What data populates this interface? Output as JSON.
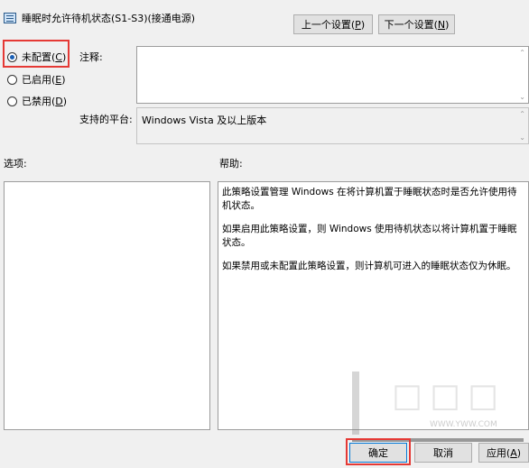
{
  "window": {
    "title": "睡眠时允许待机状态(S1-S3)(接通电源)"
  },
  "nav": {
    "prev_prefix": "上一个设置(",
    "prev_key": "P",
    "suffix": ")",
    "next_prefix": "下一个设置(",
    "next_key": "N"
  },
  "options": {
    "not_configured_prefix": "未配置(",
    "not_configured_key": "C",
    "enabled_prefix": "已启用(",
    "enabled_key": "E",
    "disabled_prefix": "已禁用(",
    "disabled_key": "D",
    "close": ")",
    "selected": "not_configured"
  },
  "comment": {
    "label": "注释:",
    "value": ""
  },
  "platform": {
    "label": "支持的平台:",
    "value": "Windows Vista 及以上版本"
  },
  "sections": {
    "options_label": "选项:",
    "help_label": "帮助:"
  },
  "help": {
    "paragraphs": [
      "此策略设置管理 Windows 在将计算机置于睡眠状态时是否允许使用待机状态。",
      "如果启用此策略设置，则 Windows 使用待机状态以将计算机置于睡眠状态。",
      "如果禁用或未配置此策略设置，则计算机可进入的睡眠状态仅为休眠。"
    ]
  },
  "footer": {
    "ok": "确定",
    "cancel": "取消",
    "apply_prefix": "应用(",
    "apply_key": "A",
    "apply_close": ")"
  },
  "watermark": {
    "url": "WWW.YWW.COM"
  },
  "colors": {
    "highlight": "#e53935",
    "radio_dot": "#1a5fb4",
    "focus_border": "#0078d7"
  }
}
